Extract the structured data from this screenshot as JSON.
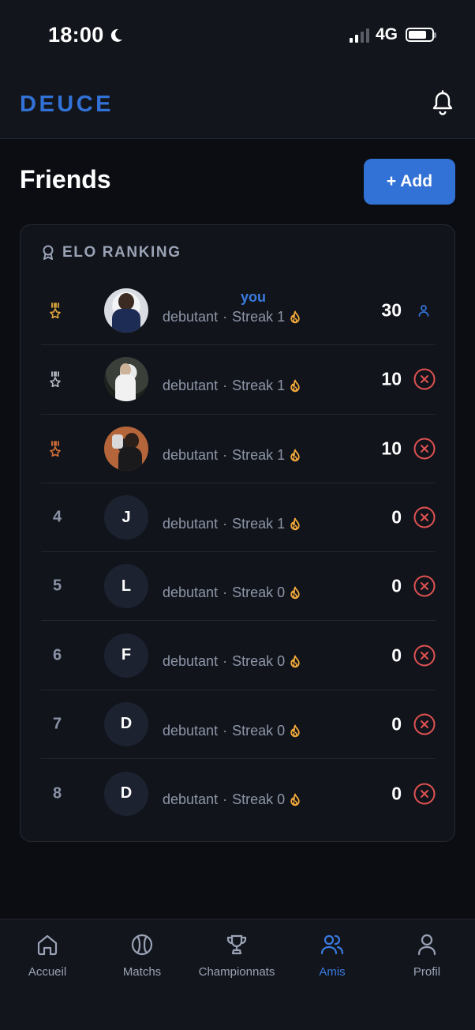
{
  "status_bar": {
    "time": "18:00",
    "network": "4G",
    "battery_level": 0.78
  },
  "header": {
    "logo": "DEUCE"
  },
  "page": {
    "title": "Friends",
    "add_label": "+ Add"
  },
  "ranking": {
    "title": "ELO RANKING",
    "rows": [
      {
        "rank": "1",
        "medal": "gold",
        "avatar_type": "photo",
        "avatar_letter": "",
        "you_label": "you",
        "level": "debutant",
        "streak": "Streak 1",
        "score": "30",
        "is_self": true
      },
      {
        "rank": "2",
        "medal": "silver",
        "avatar_type": "photo",
        "avatar_letter": "",
        "you_label": "",
        "level": "debutant",
        "streak": "Streak 1",
        "score": "10",
        "is_self": false
      },
      {
        "rank": "3",
        "medal": "bronze",
        "avatar_type": "photo",
        "avatar_letter": "",
        "you_label": "",
        "level": "debutant",
        "streak": "Streak 1",
        "score": "10",
        "is_self": false
      },
      {
        "rank": "4",
        "medal": "",
        "avatar_type": "letter",
        "avatar_letter": "J",
        "you_label": "",
        "level": "debutant",
        "streak": "Streak 1",
        "score": "0",
        "is_self": false
      },
      {
        "rank": "5",
        "medal": "",
        "avatar_type": "letter",
        "avatar_letter": "L",
        "you_label": "",
        "level": "debutant",
        "streak": "Streak 0",
        "score": "0",
        "is_self": false
      },
      {
        "rank": "6",
        "medal": "",
        "avatar_type": "letter",
        "avatar_letter": "F",
        "you_label": "",
        "level": "debutant",
        "streak": "Streak 0",
        "score": "0",
        "is_self": false
      },
      {
        "rank": "7",
        "medal": "",
        "avatar_type": "letter",
        "avatar_letter": "D",
        "you_label": "",
        "level": "debutant",
        "streak": "Streak 0",
        "score": "0",
        "is_self": false
      },
      {
        "rank": "8",
        "medal": "",
        "avatar_type": "letter",
        "avatar_letter": "D",
        "you_label": "",
        "level": "debutant",
        "streak": "Streak 0",
        "score": "0",
        "is_self": false
      }
    ]
  },
  "nav": {
    "items": [
      {
        "label": "Accueil",
        "icon": "home-icon",
        "active": false
      },
      {
        "label": "Matchs",
        "icon": "tennis-ball-icon",
        "active": false
      },
      {
        "label": "Championnats",
        "icon": "trophy-icon",
        "active": false
      },
      {
        "label": "Amis",
        "icon": "users-icon",
        "active": true
      },
      {
        "label": "Profil",
        "icon": "user-icon",
        "active": false
      }
    ]
  },
  "colors": {
    "accent": "#3272d6",
    "remove": "#e05252",
    "streak_flame": "#f2a93b",
    "gold": "#e0a93b",
    "silver": "#b8bcc6",
    "bronze": "#d9703a"
  }
}
